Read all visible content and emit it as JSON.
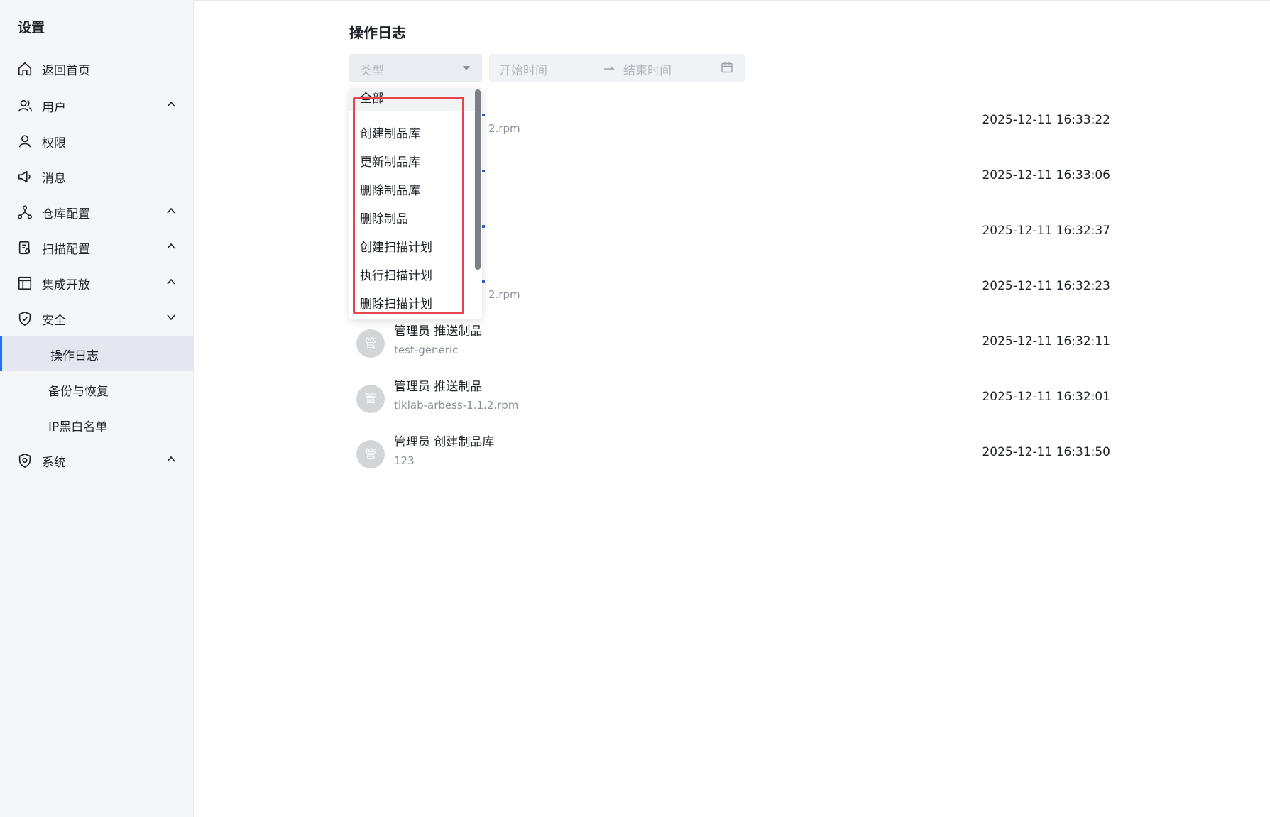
{
  "sidebar": {
    "title": "设置",
    "items": [
      {
        "label": "返回首页",
        "icon": "home-icon"
      },
      {
        "label": "用户",
        "icon": "user-group-icon",
        "arrow": "up"
      },
      {
        "label": "权限",
        "icon": "user-icon"
      },
      {
        "label": "消息",
        "icon": "megaphone-icon"
      },
      {
        "label": "仓库配置",
        "icon": "nodes-icon",
        "arrow": "up"
      },
      {
        "label": "扫描配置",
        "icon": "scan-doc-icon",
        "arrow": "up"
      },
      {
        "label": "集成开放",
        "icon": "layout-icon",
        "arrow": "up"
      },
      {
        "label": "安全",
        "icon": "shield-check-icon",
        "arrow": "down"
      },
      {
        "label": "系统",
        "icon": "shield-gear-icon",
        "arrow": "up"
      }
    ],
    "security_sub": [
      {
        "label": "操作日志",
        "active": true
      },
      {
        "label": "备份与恢复"
      },
      {
        "label": "IP黑白名单"
      }
    ]
  },
  "main": {
    "title": "操作日志",
    "filters": {
      "type_placeholder": "类型",
      "start_placeholder": "开始时间",
      "end_placeholder": "结束时间"
    },
    "dropdown": {
      "options": [
        "全部",
        "创建制品库",
        "更新制品库",
        "删除制品库",
        "删除制品",
        "创建扫描计划",
        "执行扫描计划",
        "删除扫描计划"
      ]
    },
    "logs": [
      {
        "avatar": "",
        "action": "",
        "target": "2.rpm",
        "time": "2025-12-11 16:33:22"
      },
      {
        "avatar": "",
        "action": "",
        "target": "",
        "time": "2025-12-11 16:33:06"
      },
      {
        "avatar": "",
        "action": "",
        "target": "",
        "time": "2025-12-11 16:32:37"
      },
      {
        "avatar": "",
        "action": "",
        "target": "2.rpm",
        "time": "2025-12-11 16:32:23"
      },
      {
        "avatar": "管",
        "action": "管理员 推送制品",
        "target": "test-generic",
        "time": "2025-12-11 16:32:11"
      },
      {
        "avatar": "管",
        "action": "管理员 推送制品",
        "target": "tiklab-arbess-1.1.2.rpm",
        "time": "2025-12-11 16:32:01"
      },
      {
        "avatar": "管",
        "action": "管理员 创建制品库",
        "target": "123",
        "time": "2025-12-11 16:31:50"
      }
    ]
  },
  "colors": {
    "accent": "#1e6fff",
    "highlight": "#e8434e",
    "sidebar_bg": "#f4f6f9"
  }
}
